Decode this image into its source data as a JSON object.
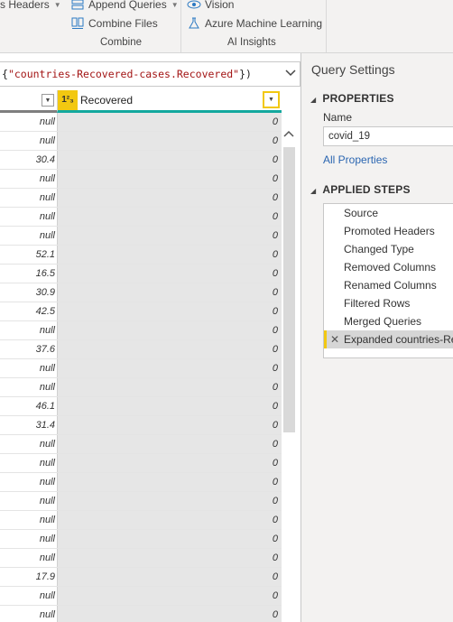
{
  "ribbon": {
    "headers_label": "s Headers",
    "append_queries": "Append Queries",
    "combine_files": "Combine Files",
    "vision": "Vision",
    "azure_ml": "Azure Machine Learning",
    "group_combine": "Combine",
    "group_ai": "AI Insights"
  },
  "formula": {
    "prefix": "{",
    "string": "\"countries-Recovered-cases.Recovered\"",
    "suffix": "})"
  },
  "grid": {
    "column_header": "Recovered",
    "type_badge": "1²₃",
    "rows": [
      {
        "left": "null",
        "recovered": "0"
      },
      {
        "left": "null",
        "recovered": "0"
      },
      {
        "left": "30.4",
        "recovered": "0"
      },
      {
        "left": "null",
        "recovered": "0"
      },
      {
        "left": "null",
        "recovered": "0"
      },
      {
        "left": "null",
        "recovered": "0"
      },
      {
        "left": "null",
        "recovered": "0"
      },
      {
        "left": "52.1",
        "recovered": "0"
      },
      {
        "left": "16.5",
        "recovered": "0"
      },
      {
        "left": "30.9",
        "recovered": "0"
      },
      {
        "left": "42.5",
        "recovered": "0"
      },
      {
        "left": "null",
        "recovered": "0"
      },
      {
        "left": "37.6",
        "recovered": "0"
      },
      {
        "left": "null",
        "recovered": "0"
      },
      {
        "left": "null",
        "recovered": "0"
      },
      {
        "left": "46.1",
        "recovered": "0"
      },
      {
        "left": "31.4",
        "recovered": "0"
      },
      {
        "left": "null",
        "recovered": "0"
      },
      {
        "left": "null",
        "recovered": "0"
      },
      {
        "left": "null",
        "recovered": "0"
      },
      {
        "left": "null",
        "recovered": "0"
      },
      {
        "left": "null",
        "recovered": "0"
      },
      {
        "left": "null",
        "recovered": "0"
      },
      {
        "left": "null",
        "recovered": "0"
      },
      {
        "left": "17.9",
        "recovered": "0"
      },
      {
        "left": "null",
        "recovered": "0"
      },
      {
        "left": "null",
        "recovered": "0"
      }
    ]
  },
  "query_settings": {
    "title": "Query Settings",
    "properties_heading": "PROPERTIES",
    "name_label": "Name",
    "name_value": "covid_19",
    "all_properties": "All Properties",
    "applied_steps_heading": "APPLIED STEPS",
    "steps": [
      "Source",
      "Promoted Headers",
      "Changed Type",
      "Removed Columns",
      "Renamed Columns",
      "Filtered Rows",
      "Merged Queries",
      "Expanded countries-Re"
    ],
    "active_step_index": 7
  },
  "colors": {
    "accent_yellow": "#f2c811",
    "column_underline": "#13a89e",
    "link_blue": "#2b66b1"
  },
  "icons": {
    "dropdown": "chevron-down-icon",
    "step_delete": "close-icon",
    "scroll_up": "chevron-up-icon"
  }
}
